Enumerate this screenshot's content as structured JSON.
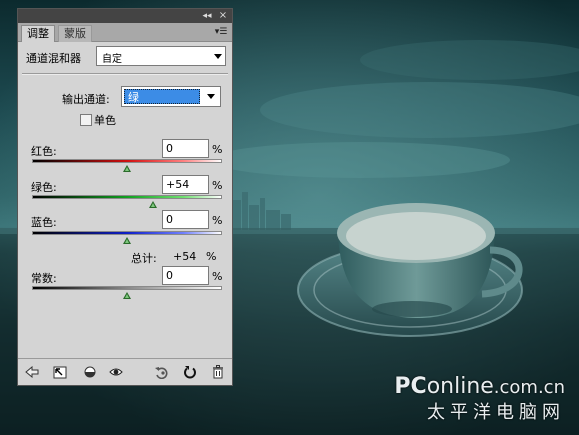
{
  "panel": {
    "tabs": [
      {
        "label": "调整",
        "active": true
      },
      {
        "label": "蒙版",
        "active": false
      }
    ],
    "title": "通道混和器",
    "preset": {
      "value": "自定"
    },
    "output_channel": {
      "label": "输出通道:",
      "value": "绿"
    },
    "monochrome": {
      "label": "单色",
      "checked": false
    },
    "channels": [
      {
        "label": "红色:",
        "value": "0",
        "unit": "%",
        "slider_fraction": 0.5
      },
      {
        "label": "绿色:",
        "value": "+54",
        "unit": "%",
        "slider_fraction": 0.635
      },
      {
        "label": "蓝色:",
        "value": "0",
        "unit": "%",
        "slider_fraction": 0.5
      }
    ],
    "total": {
      "label": "总计:",
      "value": "+54",
      "unit": "%"
    },
    "constant": {
      "label": "常数:",
      "value": "0",
      "unit": "%",
      "slider_fraction": 0.5
    },
    "bottom_icons": [
      "back-arrow-icon",
      "expand-view-icon",
      "clip-layer-icon",
      "eye-icon",
      "reset-previous-icon",
      "reset-icon",
      "trash-icon"
    ]
  },
  "titlebar": {
    "collapse_glyph": "◂◂",
    "close_glyph": "×"
  },
  "watermark": {
    "brand_pc": "PC",
    "brand_rest": "online",
    "domain": ".com.cn",
    "subtitle": "太平洋电脑网"
  },
  "colors": {
    "accent": "#3c8ce6",
    "panel_bg": "#d4d4d4"
  }
}
